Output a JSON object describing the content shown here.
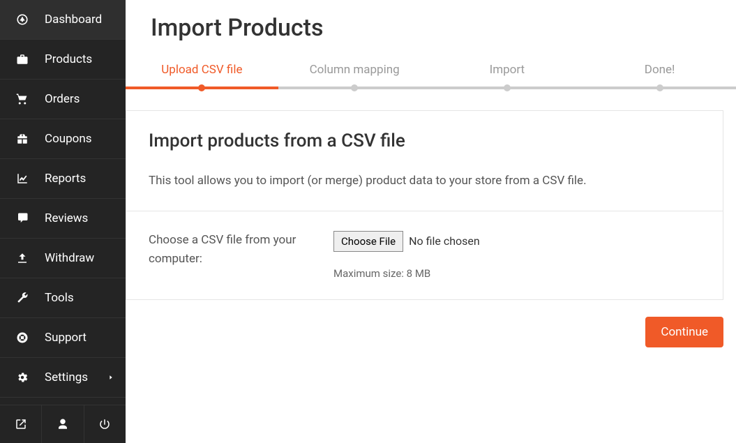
{
  "sidebar": {
    "items": [
      {
        "label": "Dashboard",
        "icon": "dashboard"
      },
      {
        "label": "Products",
        "icon": "briefcase"
      },
      {
        "label": "Orders",
        "icon": "cart"
      },
      {
        "label": "Coupons",
        "icon": "gift"
      },
      {
        "label": "Reports",
        "icon": "chart"
      },
      {
        "label": "Reviews",
        "icon": "comments"
      },
      {
        "label": "Withdraw",
        "icon": "upload"
      },
      {
        "label": "Tools",
        "icon": "wrench"
      },
      {
        "label": "Support",
        "icon": "lifering"
      },
      {
        "label": "Settings",
        "icon": "gear",
        "chevron": true
      }
    ]
  },
  "page": {
    "title": "Import Products"
  },
  "steps": [
    {
      "label": "Upload CSV file",
      "active": true
    },
    {
      "label": "Column mapping",
      "active": false
    },
    {
      "label": "Import",
      "active": false
    },
    {
      "label": "Done!",
      "active": false
    }
  ],
  "card": {
    "title": "Import products from a CSV file",
    "description": "This tool allows you to import (or merge) product data to your store from a CSV file.",
    "field_label": "Choose a CSV file from your computer:",
    "choose_file_label": "Choose File",
    "file_status": "No file chosen",
    "hint": "Maximum size: 8 MB"
  },
  "actions": {
    "continue_label": "Continue"
  }
}
